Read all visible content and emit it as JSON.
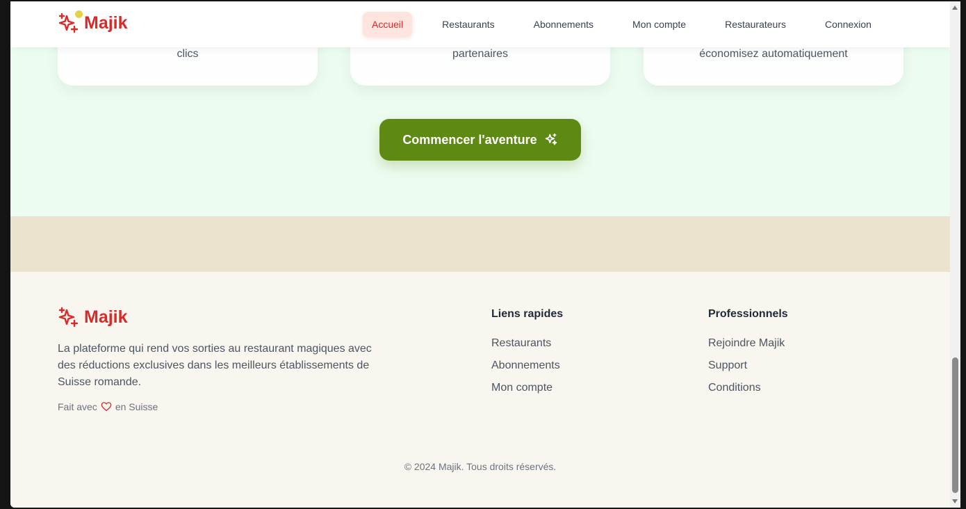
{
  "brand": {
    "name": "Majik",
    "color": "#d92a2a",
    "accent_dot_color": "#e3d34a"
  },
  "nav": {
    "items": [
      {
        "label": "Accueil",
        "active": true
      },
      {
        "label": "Restaurants",
        "active": false
      },
      {
        "label": "Abonnements",
        "active": false
      },
      {
        "label": "Mon compte",
        "active": false
      },
      {
        "label": "Restaurateurs",
        "active": false
      },
      {
        "label": "Connexion",
        "active": false
      }
    ]
  },
  "hero": {
    "cards": [
      {
        "text": "clics"
      },
      {
        "text": "partenaires"
      },
      {
        "text": "économisez automatiquement"
      }
    ],
    "cta_label": "Commencer l'aventure",
    "cta_icon": "sparkles-icon",
    "cta_color": "#5e8a14"
  },
  "footer": {
    "description": "La plateforme qui rend vos sorties au restaurant magiques avec des réductions exclusives dans les meilleurs établissements de Suisse romande.",
    "made_with_prefix": "Fait avec",
    "made_with_icon": "heart-icon",
    "made_with_suffix": "en Suisse",
    "quick_links": {
      "title": "Liens rapides",
      "items": [
        "Restaurants",
        "Abonnements",
        "Mon compte"
      ]
    },
    "professionals": {
      "title": "Professionnels",
      "items": [
        "Rejoindre Majik",
        "Support",
        "Conditions"
      ]
    },
    "copyright": "© 2024 Majik. Tous droits réservés."
  }
}
